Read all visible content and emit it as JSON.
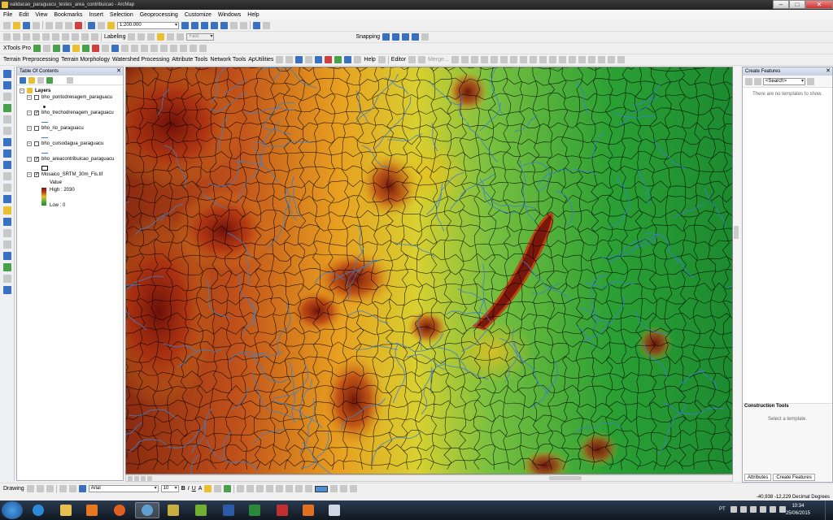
{
  "window": {
    "title": "validacao_paraguacu_testes_area_contribuicao - ArcMap",
    "controls": {
      "minimize": "–",
      "maximize": "□",
      "close": "✕"
    }
  },
  "menu": [
    "File",
    "Edit",
    "View",
    "Bookmarks",
    "Insert",
    "Selection",
    "Geoprocessing",
    "Customize",
    "Windows",
    "Help"
  ],
  "standard_toolbar": {
    "scale": "1:200.000"
  },
  "labeling_toolbar": {
    "labeling": "Labeling",
    "speed": "Fast"
  },
  "snapping_toolbar": {
    "snapping": "Snapping"
  },
  "extensions_toolbar": {
    "xtools": "XTools Pro",
    "items": [
      "Terrain Preprocessing",
      "Terrain Morphology",
      "Watershed Processing",
      "Attribute Tools",
      "Network Tools",
      "ApUtilities"
    ],
    "help": "Help",
    "editor": "Editor",
    "merge": "Merge..."
  },
  "toc": {
    "title": "Table Of Contents",
    "root": "Layers",
    "layers": [
      {
        "name": "bho_pontodrenagem_paraguacu",
        "checked": false,
        "symbol": "point"
      },
      {
        "name": "bho_trechodrenagem_paraguacu",
        "checked": true,
        "symbol": "line"
      },
      {
        "name": "bho_rio_paraguacu",
        "checked": false,
        "symbol": "line"
      },
      {
        "name": "bho_cursodagua_paraguacu",
        "checked": false,
        "symbol": "line"
      },
      {
        "name": "bho_areacontribuicao_paraguacu",
        "checked": true,
        "symbol": "polygon"
      },
      {
        "name": "Mosaico_SRTM_30m_Fis.tif",
        "checked": true,
        "symbol": "raster"
      }
    ],
    "raster_legend": {
      "field": "Value",
      "high": "High : 2030",
      "low": "Low : 0"
    }
  },
  "create_features": {
    "title": "Create Features",
    "search_placeholder": "<Search>",
    "no_templates": "There are no templates to show.",
    "construction_tools": "Construction Tools",
    "select_template": "Select a template.",
    "tabs": [
      "Attributes",
      "Create Features"
    ]
  },
  "drawing_toolbar": {
    "drawing": "Drawing",
    "font": "Arial",
    "size": "10",
    "bold": "B",
    "italic": "I",
    "underline": "U",
    "font_color": "A",
    "fill_color": "#4e8ed6"
  },
  "status": {
    "coordinates": "-40,938  -12,229 Decimal Degrees"
  },
  "taskbar": {
    "language": "PT",
    "time": "10:34",
    "date": "25/06/2015",
    "apps": [
      "windows-explorer",
      "ie-browser",
      "file-explorer",
      "media-player",
      "firefox",
      "arcmap",
      "box-app",
      "qgis",
      "word",
      "excel",
      "access",
      "powerpoint",
      "document"
    ]
  },
  "colors": {
    "dem_high": "#7a1010",
    "dem_mid": "#e8c020",
    "dem_low": "#1e8c2a",
    "drainage": "#3a80d0",
    "catchments": "#000000"
  }
}
